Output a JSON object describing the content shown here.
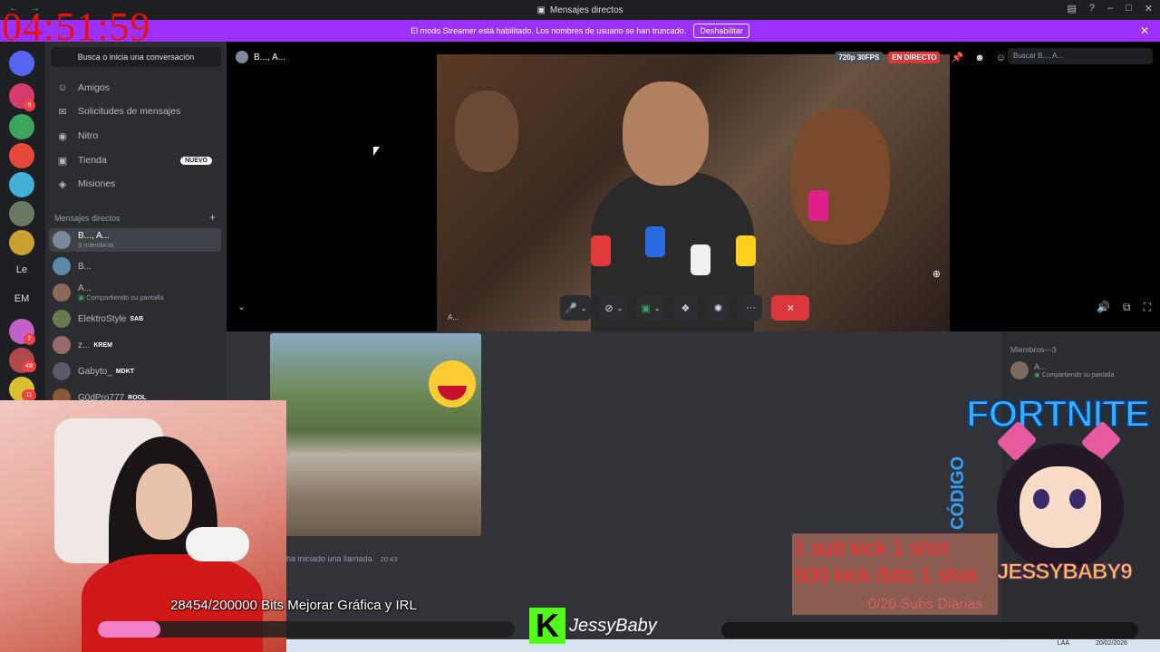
{
  "window": {
    "title": "Mensajes directos"
  },
  "stream_overlay": {
    "timer": "04:51:59",
    "bits_goal": "28454/200000 Bits Mejorar Gráfica y IRL",
    "bits_progress": 0.142,
    "channel_name": "JessyBaby",
    "promo_title": "FORTNITE",
    "promo_code_label": "CÓDIGO",
    "promo_code": "JESSYBABY9",
    "sub_line1": "1 sub  kick 1 shot",
    "sub_line2": "500 kick /bits 1 shot",
    "sub_counter": "0/20 Subs Diarias"
  },
  "banner": {
    "text": "El modo Streamer está habilitado. Los nombres de usuario se han truncado.",
    "button": "Deshabilitar"
  },
  "servers": {
    "text_items": [
      "Le",
      "EM"
    ],
    "badges": [
      "9",
      "2",
      "48",
      "11"
    ]
  },
  "dm_panel": {
    "search_placeholder": "Busca o inicia una conversación",
    "nav": [
      {
        "label": "Amigos",
        "icon": "friends-icon"
      },
      {
        "label": "Solicitudes de mensajes",
        "icon": "mail-icon"
      },
      {
        "label": "Nitro",
        "icon": "nitro-icon"
      },
      {
        "label": "Tienda",
        "icon": "shop-icon",
        "badge": "NUEVO"
      },
      {
        "label": "Misiones",
        "icon": "quests-icon"
      }
    ],
    "dm_header": "Mensajes directos",
    "dms": [
      {
        "name": "B..., A...",
        "sub": "3 miembros",
        "color": "#7a8a9a"
      },
      {
        "name": "B...",
        "sub": "",
        "color": "#5b8aa8"
      },
      {
        "name": "A...",
        "sub": "Compartiendo su pantalla",
        "color": "#8a6a5a"
      },
      {
        "name": "ElektroStyle",
        "sub": "",
        "tag": "SAB",
        "color": "#6a7a50"
      },
      {
        "name": "z...",
        "sub": "",
        "tag": "KREM",
        "color": "#9a6a6a"
      },
      {
        "name": "Gabyto_",
        "sub": "",
        "tag": "MDKT",
        "color": "#5a5a6a"
      },
      {
        "name": "G0dPro777",
        "sub": "",
        "tag": "ROOL",
        "color": "#8a5a3a"
      }
    ]
  },
  "call": {
    "name": "B..., A...",
    "quality": "720p 30FPS",
    "live": "EN DIRECTO",
    "search_placeholder": "Buscar B..., A...",
    "stream_label": "A..."
  },
  "chat": {
    "call_started": "ha iniciado una llamada.",
    "call_time": "20:43"
  },
  "members": {
    "header": "Miembros—3",
    "items": [
      {
        "name": "A...",
        "sub": "Compartiendo su pantalla"
      }
    ]
  },
  "taskbar": {
    "lang": "LAA",
    "date": "20/02/2026"
  }
}
